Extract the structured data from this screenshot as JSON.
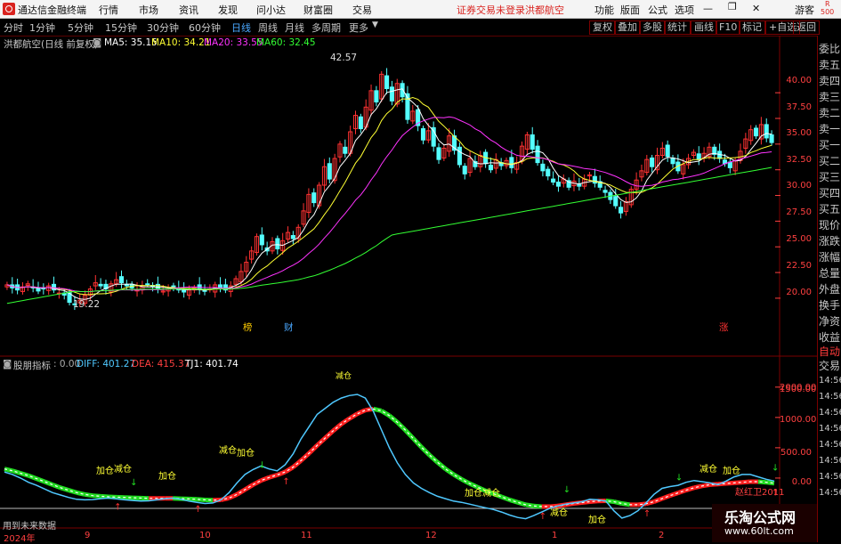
{
  "menubar": {
    "app_title": "通达信金融终端",
    "items": [
      "行情",
      "市场",
      "资讯",
      "发现",
      "问小达",
      "财富圈",
      "交易"
    ],
    "notice": "证券交易未登录",
    "stock": "洪都航空",
    "right": [
      "功能",
      "版面",
      "公式",
      "选项"
    ],
    "guest": "游客",
    "r_badge": "R",
    "r_num": "500"
  },
  "toolbar": {
    "periods": [
      "分时",
      "1分钟",
      "5分钟",
      "15分钟",
      "30分钟",
      "60分钟",
      "日线",
      "周线",
      "月线",
      "多周期",
      "更多"
    ],
    "selected": "日线",
    "buttons": [
      "复权",
      "叠加",
      "多股",
      "统计",
      "画线",
      "F10",
      "标记",
      "+自选",
      "返回"
    ]
  },
  "main_panel": {
    "title": "洪都航空(日线 前复权)",
    "ma": [
      {
        "label": "MA5: 35.15",
        "color": "#ffffff"
      },
      {
        "label": "MA10: 34.21",
        "color": "#ffff33"
      },
      {
        "label": "MA20: 33.55",
        "color": "#ff33ff"
      },
      {
        "label": "MA60: 32.45",
        "color": "#33ff33"
      }
    ],
    "high_label": "42.57",
    "low_label": "19.22",
    "event_markers": [
      {
        "text": "榜",
        "color": "#ffcc00"
      },
      {
        "text": "财",
        "color": "#4aa8ff"
      },
      {
        "text": "涨",
        "color": "#ff3333"
      }
    ]
  },
  "sub_panel": {
    "title": "股朋指标",
    "zero": ": 0.00",
    "diff": "DIFF: 401.27",
    "dea": "DEA: 415.37",
    "tj1": "TJ1: 401.74",
    "top_label": "减仓",
    "future_note": "用到未来数据",
    "copyright": "赵红卫2011",
    "signals": [
      {
        "text": "加仓",
        "color": "#ffff33"
      },
      {
        "text": "减仓",
        "color": "#ffff33"
      },
      {
        "text": "加仓",
        "color": "#ffff33"
      },
      {
        "text": "减仓",
        "color": "#ffff33"
      },
      {
        "text": "加仓",
        "color": "#ffff33"
      },
      {
        "text": "加仓",
        "color": "#ffff33"
      },
      {
        "text": "减仓",
        "color": "#ffff33"
      },
      {
        "text": "减仓",
        "color": "#ffff33"
      },
      {
        "text": "加仓",
        "color": "#ffff33"
      },
      {
        "text": "减仓",
        "color": "#ffff33"
      },
      {
        "text": "加仓",
        "color": "#ffff33"
      }
    ]
  },
  "xaxis": {
    "labels": [
      "2024年",
      "9",
      "10",
      "11",
      "12",
      "1",
      "2"
    ]
  },
  "right_panel": {
    "items": [
      "委比",
      "卖五",
      "卖四",
      "卖三",
      "卖二",
      "卖一",
      "买一",
      "买二",
      "买三",
      "买四",
      "买五",
      "现价",
      "涨跌",
      "涨幅",
      "总量",
      "外盘",
      "换手",
      "净资",
      "收益"
    ],
    "bottom": [
      "自动",
      "交易"
    ],
    "times": [
      "14:56",
      "14:56",
      "14:56",
      "14:56",
      "14:56",
      "14:56",
      "14:56",
      "14:56"
    ]
  },
  "watermark": {
    "title": "乐淘公式网",
    "url": "www.60lt.com"
  },
  "chart_data": [
    {
      "type": "candlestick",
      "title": "洪都航空(日线 前复权)",
      "ylim": [
        18,
        44
      ],
      "y_ticks": [
        20.0,
        22.5,
        25.0,
        27.5,
        30.0,
        32.5,
        35.0,
        37.5,
        40.0
      ],
      "x_labels": [
        "2024年",
        "9",
        "10",
        "11",
        "12",
        "1",
        "2"
      ],
      "close": [
        21.3,
        21.0,
        20.8,
        21.1,
        21.4,
        21.0,
        20.7,
        20.9,
        21.2,
        20.8,
        20.5,
        20.3,
        19.6,
        19.4,
        19.8,
        20.3,
        20.9,
        21.5,
        21.2,
        20.9,
        21.4,
        21.8,
        21.5,
        21.2,
        21.0,
        20.8,
        21.1,
        21.4,
        21.2,
        20.9,
        20.7,
        20.9,
        21.1,
        20.8,
        20.6,
        20.8,
        21.0,
        20.9,
        20.7,
        20.9,
        21.3,
        21.0,
        20.8,
        21.2,
        21.9,
        22.6,
        23.5,
        24.6,
        26.0,
        25.2,
        24.6,
        25.5,
        24.8,
        25.6,
        26.4,
        25.8,
        26.9,
        28.5,
        30.1,
        29.3,
        31.0,
        32.8,
        31.6,
        33.6,
        35.0,
        34.1,
        36.2,
        37.8,
        36.5,
        38.6,
        40.2,
        39.1,
        41.8,
        40.4,
        39.2,
        40.9,
        39.6,
        37.4,
        38.2,
        36.8,
        35.4,
        36.3,
        34.8,
        33.5,
        34.6,
        35.8,
        34.4,
        33.0,
        32.1,
        33.6,
        32.8,
        33.9,
        33.1,
        32.5,
        33.5,
        32.9,
        33.4,
        32.7,
        33.2,
        34.8,
        35.9,
        34.5,
        33.2,
        32.4,
        31.9,
        31.3,
        30.9,
        31.6,
        30.8,
        31.4,
        30.9,
        31.6,
        32.0,
        31.2,
        30.8,
        30.3,
        29.6,
        29.0,
        28.3,
        29.4,
        30.6,
        31.5,
        32.4,
        33.5,
        32.8,
        33.9,
        34.6,
        33.8,
        33.1,
        32.4,
        33.0,
        33.6,
        34.2,
        33.5,
        34.1,
        34.7,
        34.0,
        33.6,
        33.1,
        32.7,
        33.4,
        34.3,
        35.5,
        36.4,
        35.8,
        36.9,
        35.6,
        35.15
      ],
      "ma5_last": 35.15,
      "ma10_last": 34.21,
      "ma20_last": 33.55,
      "ma60_last": 32.45,
      "annotations": [
        {
          "text": "42.57",
          "value": 42.57
        },
        {
          "text": "19.22",
          "value": 19.22
        }
      ]
    },
    {
      "type": "line",
      "title": "股朋指标",
      "ylim": [
        -250,
        2100
      ],
      "y_ticks": [
        0.0,
        500.0,
        1000.0,
        1500.0,
        2000.0
      ],
      "series": [
        {
          "name": "DIFF",
          "color": "#4fc8ff",
          "values": [
            600,
            560,
            500,
            430,
            380,
            320,
            260,
            220,
            180,
            150,
            140,
            145,
            160,
            170,
            155,
            140,
            130,
            120,
            125,
            140,
            160,
            170,
            150,
            120,
            100,
            80,
            90,
            140,
            260,
            420,
            560,
            640,
            700,
            650,
            620,
            720,
            900,
            1150,
            1350,
            1550,
            1650,
            1750,
            1820,
            1860,
            1880,
            1820,
            1600,
            1300,
            1000,
            750,
            560,
            420,
            330,
            260,
            200,
            160,
            120,
            100,
            70,
            40,
            10,
            -20,
            -60,
            -110,
            -150,
            -170,
            -120,
            -60,
            0,
            40,
            70,
            90,
            110,
            150,
            140,
            120,
            -40,
            -160,
            -120,
            -40,
            90,
            230,
            330,
            360,
            380,
            430,
            460,
            440,
            420,
            390,
            450,
            520,
            560,
            560,
            520,
            480,
            450
          ]
        },
        {
          "name": "DEA",
          "color": "#ff3030",
          "values": [
            650,
            620,
            580,
            540,
            490,
            440,
            390,
            340,
            300,
            260,
            230,
            210,
            200,
            190,
            185,
            180,
            175,
            170,
            165,
            165,
            165,
            165,
            160,
            155,
            150,
            140,
            135,
            140,
            170,
            230,
            310,
            390,
            460,
            510,
            550,
            600,
            680,
            790,
            910,
            1040,
            1160,
            1280,
            1390,
            1480,
            1560,
            1620,
            1640,
            1610,
            1530,
            1420,
            1290,
            1150,
            1010,
            880,
            760,
            650,
            560,
            480,
            410,
            350,
            290,
            240,
            190,
            140,
            100,
            60,
            40,
            30,
            30,
            40,
            60,
            80,
            95,
            110,
            120,
            125,
            110,
            80,
            60,
            60,
            75,
            110,
            160,
            210,
            255,
            300,
            340,
            370,
            390,
            400,
            410,
            420,
            430,
            440,
            440,
            430,
            415
          ]
        },
        {
          "name": "TJ1",
          "color": "#ffffff",
          "last": 401.74
        }
      ]
    }
  ]
}
